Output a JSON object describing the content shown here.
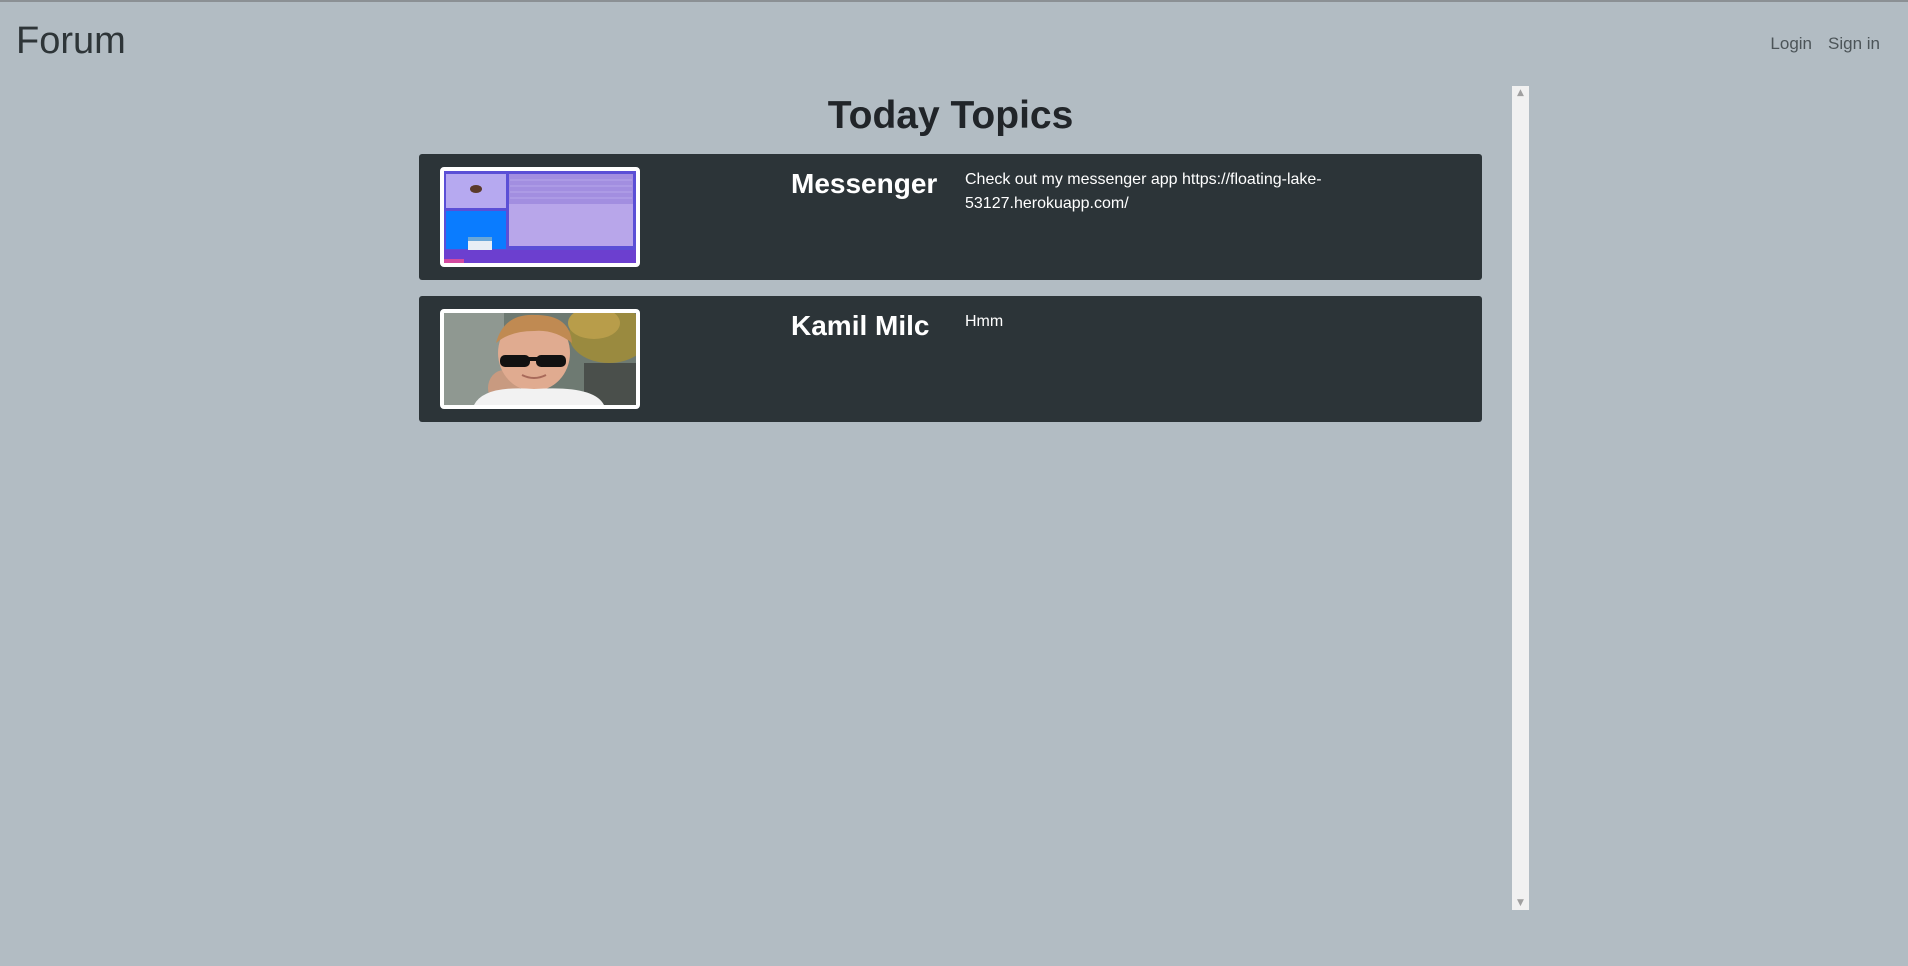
{
  "header": {
    "brand": "Forum",
    "nav": [
      {
        "label": "Login"
      },
      {
        "label": "Sign in"
      }
    ]
  },
  "main": {
    "title": "Today Topics",
    "topics": [
      {
        "name": "Messenger",
        "text": "Check out my messenger app https://floating-lake-53127.herokuapp.com/",
        "thumbnail": "messenger-app-screenshot"
      },
      {
        "name": "Kamil Milc",
        "text": "Hmm",
        "thumbnail": "person-photo-sunglasses"
      }
    ]
  },
  "scrollbar": {
    "up_icon": "▲",
    "down_icon": "▼"
  },
  "colors": {
    "background": "#b2bcc3",
    "card": "#2c3438",
    "title": "#212529"
  }
}
